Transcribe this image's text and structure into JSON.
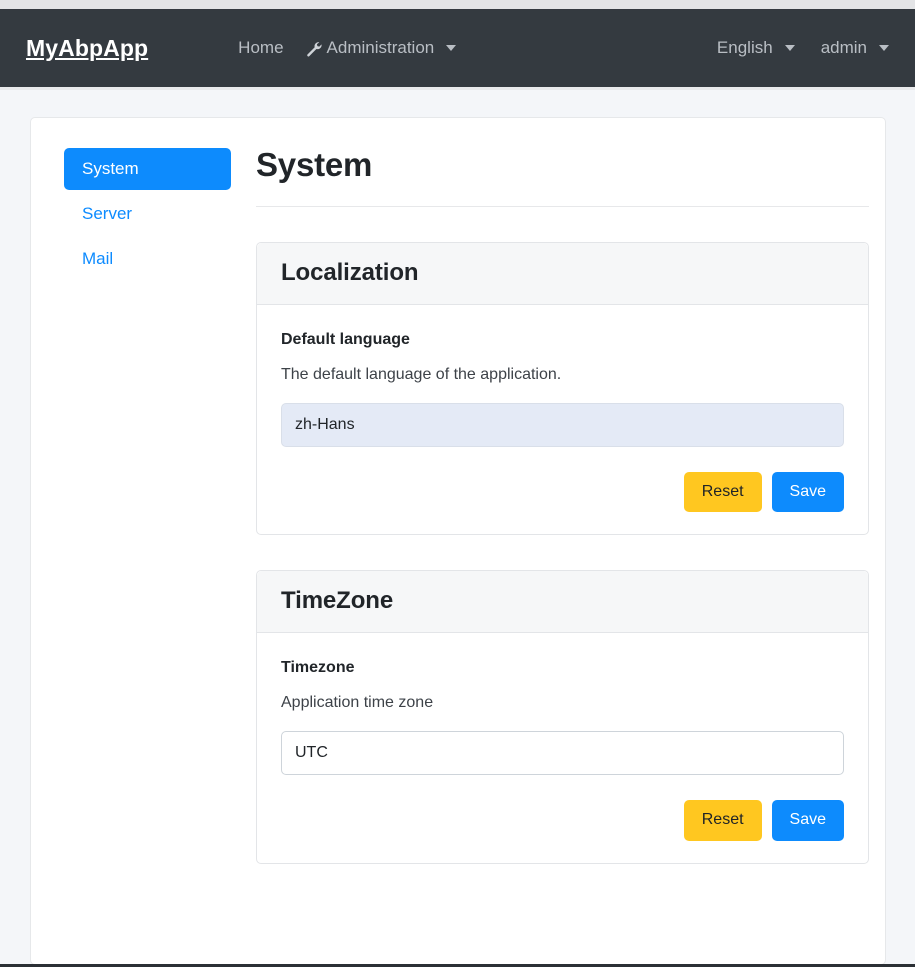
{
  "navbar": {
    "brand": "MyAbpApp",
    "links": [
      {
        "label": "Home",
        "icon": "",
        "caret": false
      },
      {
        "label": "Administration",
        "icon": "wrench-icon",
        "caret": true
      }
    ],
    "language": "English",
    "user": "admin"
  },
  "sidebar": {
    "items": [
      {
        "label": "System",
        "active": true
      },
      {
        "label": "Server",
        "active": false
      },
      {
        "label": "Mail",
        "active": false
      }
    ]
  },
  "main": {
    "title": "System",
    "cards": [
      {
        "header": "Localization",
        "field_label": "Default language",
        "field_desc": "The default language of the application.",
        "value": "zh-Hans",
        "reset_label": "Reset",
        "save_label": "Save"
      },
      {
        "header": "TimeZone",
        "field_label": "Timezone",
        "field_desc": "Application time zone",
        "value": "UTC",
        "reset_label": "Reset",
        "save_label": "Save"
      }
    ]
  },
  "colors": {
    "navbar_bg": "#343a40",
    "accent_blue": "#0d8bfd",
    "warning_yellow": "#ffc720",
    "page_bg": "#f4f6f9",
    "autofill_bg": "#e4eaf6"
  }
}
